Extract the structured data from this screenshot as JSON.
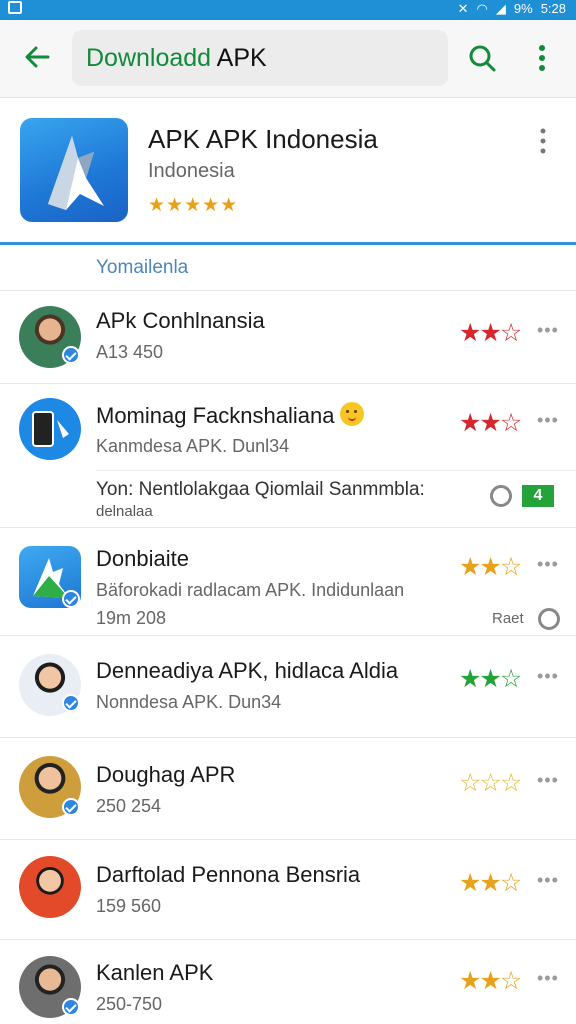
{
  "status_bar": {
    "battery": "9%",
    "time": "5:28"
  },
  "toolbar": {
    "title_part1": "Downloadd",
    "title_part2": " APK"
  },
  "app": {
    "name": "APK APK Indonesia",
    "subtitle": "Indonesia",
    "stars": "★★★★★"
  },
  "section": {
    "label": "Yomailenla"
  },
  "rows": [
    {
      "title": "APk Conhlnansia",
      "meta": "A13 450",
      "stars": "★★☆",
      "star_color": "#d9262c",
      "more": "•••"
    },
    {
      "title": "Mominag Facknshaliana",
      "meta": "Kanmdesa APK. Dunl34",
      "stars": "★★☆",
      "star_color": "#d9262c",
      "more": "•••",
      "sub": {
        "text1": "Yon: Nentlolakgaa Qiomlail Sanmmbla:",
        "text2": "delnalaa",
        "green_label": "4"
      }
    },
    {
      "title": "Donbiaite",
      "meta": "Bäforokadi radlacam APK. Indidunlaan",
      "meta2": "19m 208",
      "stars": "★★☆",
      "star_color": "#e8a21a",
      "more": "•••",
      "side_text": "Raet"
    },
    {
      "title": "Denneadiya APK, hidlaca Aldia",
      "meta": "Nonndesa APK. Dun34",
      "stars": "★★☆",
      "star_color": "#24a33a",
      "more": "•••"
    },
    {
      "title": "Doughag APR",
      "meta": "250 254",
      "stars": "☆☆☆",
      "star_color": "#e8b62a",
      "more": "•••"
    },
    {
      "title": "Darftolad Pennona Bensria",
      "meta": "159 560",
      "stars": "★★☆",
      "star_color": "#e8a21a",
      "more": "•••"
    },
    {
      "title": "Kanlen APK",
      "meta": "250-750",
      "stars": "★★☆",
      "star_color": "#e8a21a",
      "more": "•••"
    }
  ]
}
